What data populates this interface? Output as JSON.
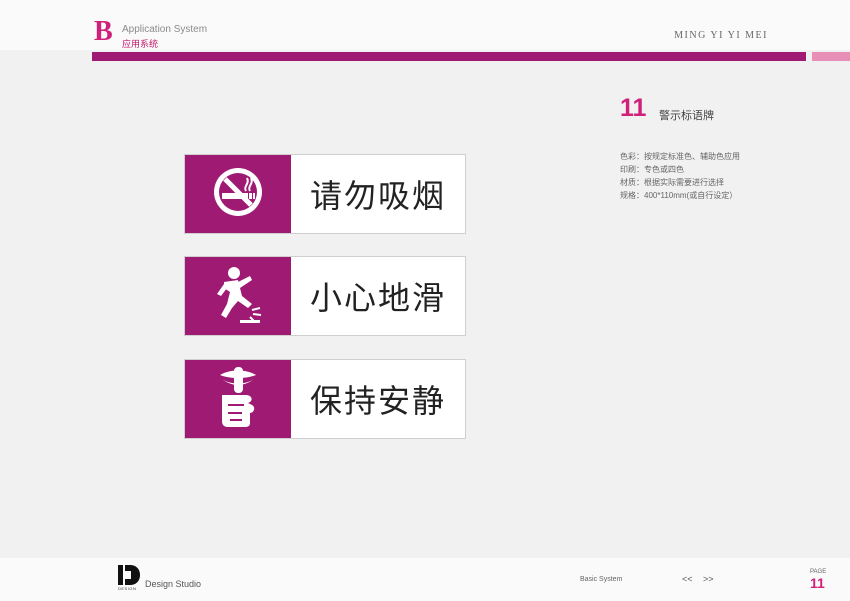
{
  "header": {
    "section_letter": "B",
    "section_title_en": "Application System",
    "section_title_cn": "应用系统",
    "brand": "MING YI YI MEI"
  },
  "colors": {
    "primary": "#9e1a73",
    "accent": "#d0207a",
    "accent_light": "#e78fb6"
  },
  "content": {
    "number": "11",
    "heading": "警示标语牌",
    "specs": [
      "色彩：按规定标准色、辅助色应用",
      "印刷：专色或四色",
      "材质：根据实际需要进行选择",
      "规格：400*110mm(或自行设定）"
    ]
  },
  "signs": [
    {
      "icon": "no-smoking-icon",
      "label": "请勿吸烟"
    },
    {
      "icon": "slippery-floor-icon",
      "label": "小心地滑"
    },
    {
      "icon": "keep-quiet-icon",
      "label": "保持安静"
    }
  ],
  "footer": {
    "logo_text": "DESIGN",
    "studio": "Design Studio",
    "section": "Basic System",
    "prev": "<<",
    "next": ">>",
    "page_label": "PAGE",
    "page_number": "11"
  }
}
